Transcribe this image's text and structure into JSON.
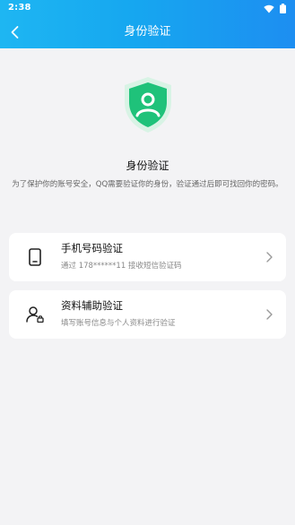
{
  "status_bar": {
    "time": "2:38",
    "icons": [
      "wifi-icon",
      "battery-icon"
    ]
  },
  "nav": {
    "title": "身份验证",
    "back_icon": "chevron-left-icon"
  },
  "hero": {
    "icon": "shield-user-icon",
    "title": "身份验证",
    "description": "为了保护你的账号安全，QQ需要验证你的身份，验证通过后即可找回你的密码。"
  },
  "options": [
    {
      "title": "手机号码验证",
      "subtitle": "通过 178******11 接收短信验证码",
      "icon": "phone-icon"
    },
    {
      "title": "资料辅助验证",
      "subtitle": "填写账号信息与个人资料进行验证",
      "icon": "user-profile-icon"
    }
  ],
  "colors": {
    "header_start": "#1eb6f2",
    "header_end": "#1d8ef1",
    "shield_green": "#1fc27a",
    "background": "#f3f3f5"
  }
}
